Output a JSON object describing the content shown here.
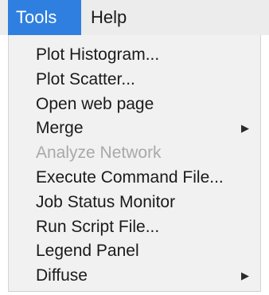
{
  "menubar": {
    "tools_label": "Tools",
    "help_label": "Help",
    "active_color": "#2f7fe0"
  },
  "menu": {
    "items": [
      {
        "label": "Plot Histogram...",
        "enabled": true,
        "has_submenu": false
      },
      {
        "label": "Plot Scatter...",
        "enabled": true,
        "has_submenu": false
      },
      {
        "label": "Open web page",
        "enabled": true,
        "has_submenu": false
      },
      {
        "label": "Merge",
        "enabled": true,
        "has_submenu": true
      },
      {
        "label": "Analyze Network",
        "enabled": false,
        "has_submenu": false
      },
      {
        "label": "Execute Command File...",
        "enabled": true,
        "has_submenu": false
      },
      {
        "label": "Job Status Monitor",
        "enabled": true,
        "has_submenu": false
      },
      {
        "label": "Run Script File...",
        "enabled": true,
        "has_submenu": false
      },
      {
        "label": "Legend Panel",
        "enabled": true,
        "has_submenu": false
      },
      {
        "label": "Diffuse",
        "enabled": true,
        "has_submenu": true
      }
    ],
    "submenu_arrow": "▶",
    "submenu_arrow_icon": "triangle-right-icon"
  }
}
